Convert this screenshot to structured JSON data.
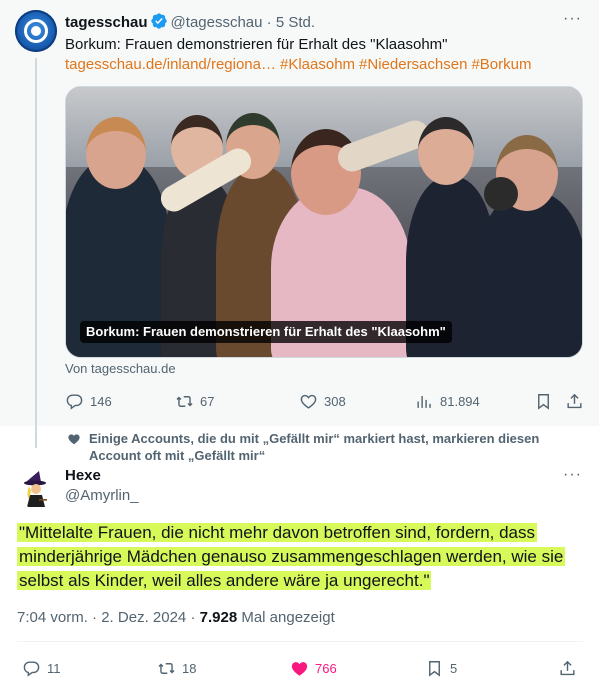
{
  "tweet": {
    "author_name": "tagesschau",
    "handle": "@tagesschau",
    "separator": "·",
    "time_ago": "5 Std.",
    "more": "···",
    "text": "Borkum: Frauen demonstrieren für Erhalt des \"Klaasohm\"",
    "link": "tagesschau.de/inland/regiona…",
    "hashtags": [
      "#Klaasohm",
      "#Niedersachsen",
      "#Borkum"
    ],
    "media_caption": "Borkum: Frauen demonstrieren für Erhalt des \"Klaasohm\"",
    "source": "Von tagesschau.de",
    "replies": "146",
    "reposts": "67",
    "likes": "308",
    "views": "81.894",
    "icons": [
      "reply-icon",
      "repost-icon",
      "like-icon",
      "views-icon",
      "bookmark-icon",
      "share-icon"
    ]
  },
  "social_context": {
    "text": "Einige Accounts, die du mit „Gefällt mir“ markiert hast, markieren diesen Account oft mit „Gefällt mir“",
    "icon": "heart-icon"
  },
  "reply": {
    "author_name": "Hexe",
    "handle": "@Amyrlin_",
    "more": "···",
    "text_lines": [
      "\"Mittelalte Frauen, die nicht mehr davon betroffen sind, fordern, dass",
      "minderjährige Mädchen genauso zusammengeschlagen werden, wie sie",
      "selbst als Kinder, weil alles andere wäre ja ungerecht.\""
    ],
    "highlight_color": "#d8f95a",
    "time": "7:04 vorm.",
    "separator": "·",
    "date": "2. Dez. 2024",
    "views_count": "7.928",
    "views_label": "Mal angezeigt",
    "replies": "11",
    "reposts": "18",
    "likes": "766",
    "bookmarks": "5",
    "like_color": "#f91880"
  },
  "colors": {
    "link": "#e0761a",
    "secondary_text": "#536471",
    "verified": "#1d9bf0"
  }
}
